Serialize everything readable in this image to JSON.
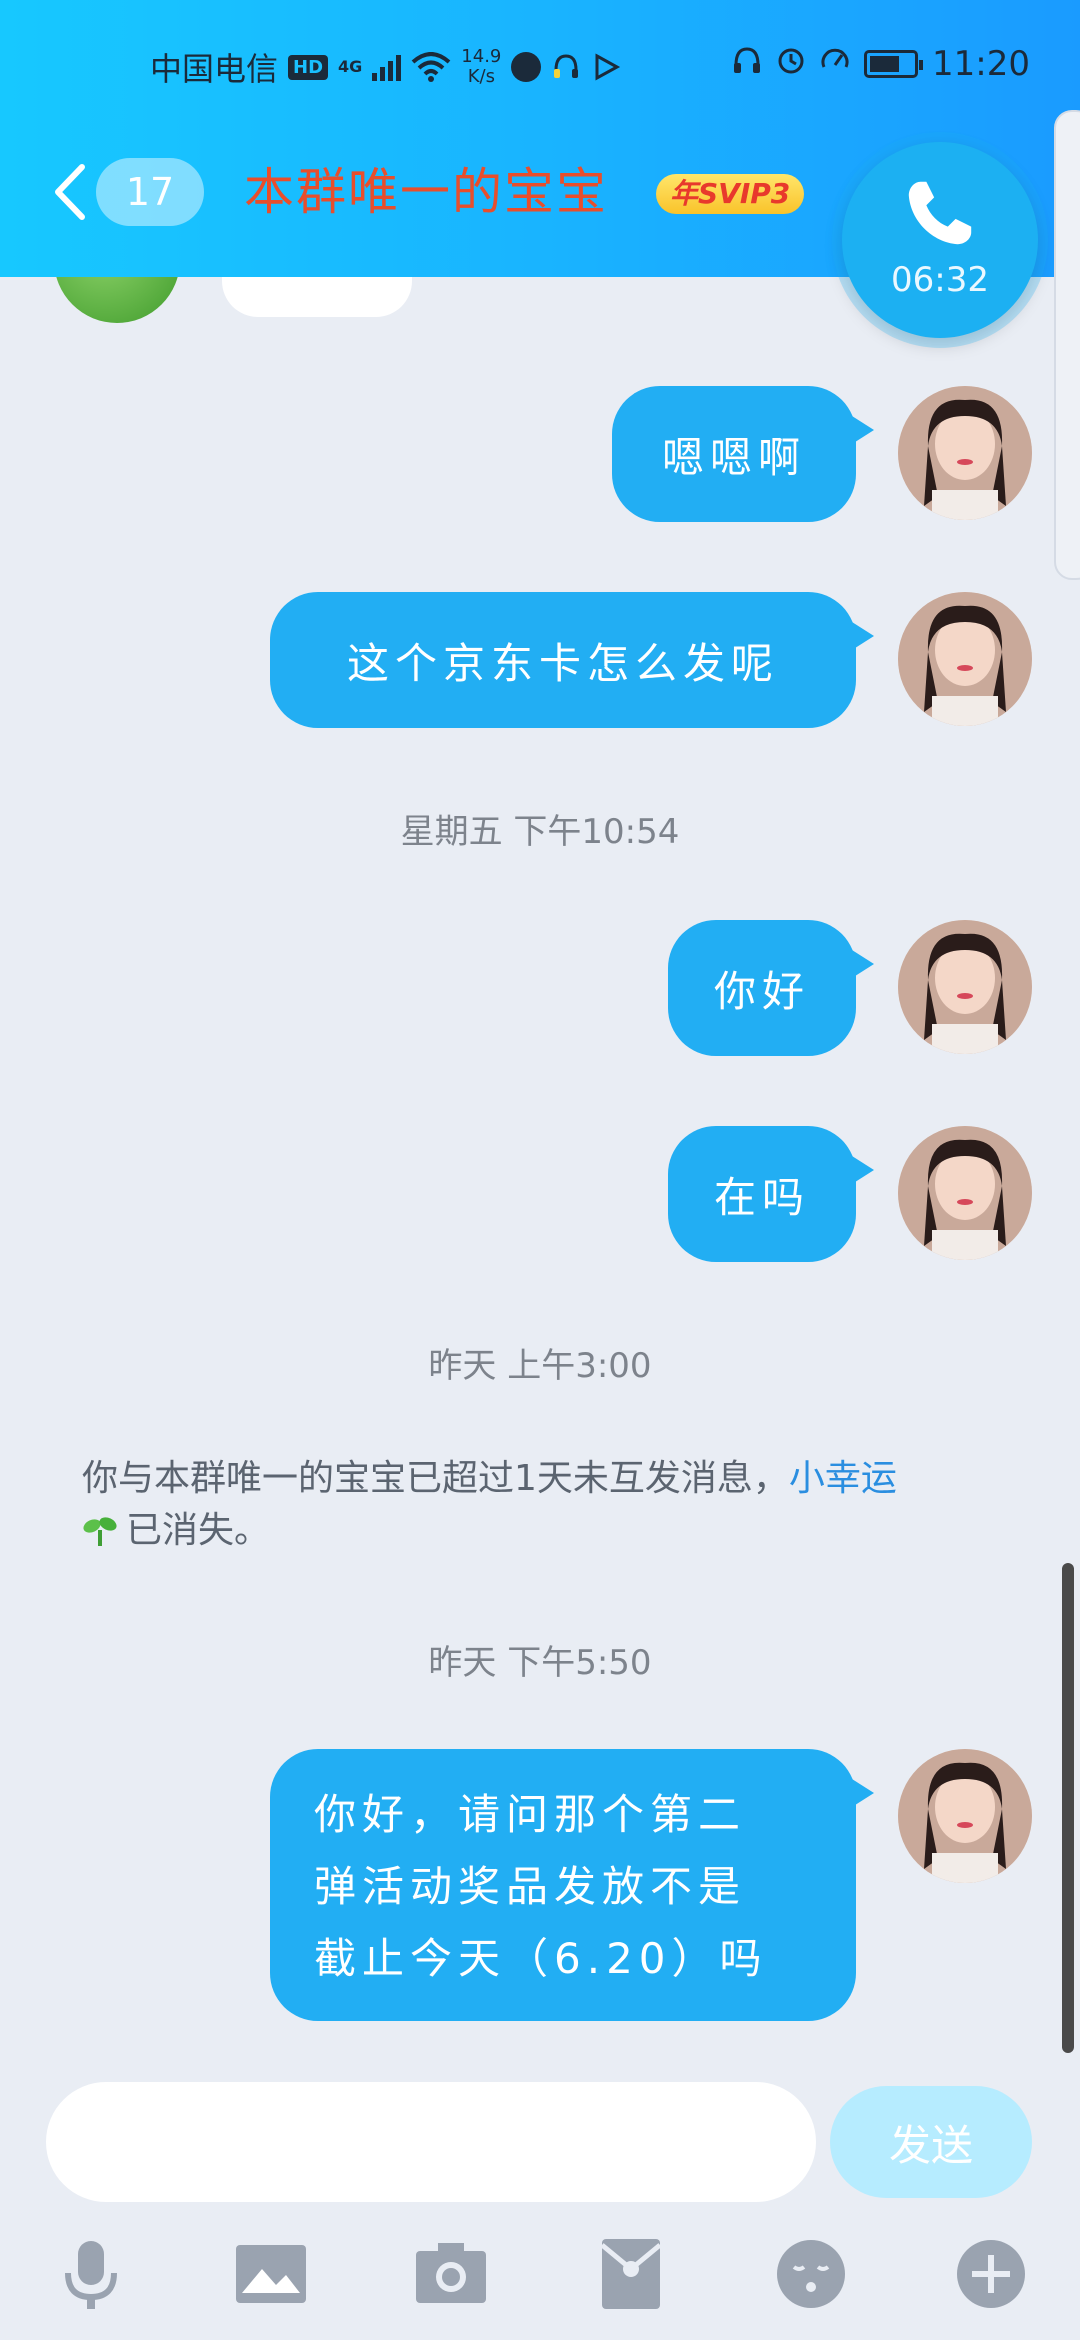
{
  "status_bar": {
    "carrier": "中国电信",
    "hd_badge": "HD",
    "network": "4G",
    "speed_value": "14.9",
    "speed_unit": "K/s",
    "time": "11:20"
  },
  "header": {
    "unread_count": "17",
    "title": "本群唯一的宝宝",
    "vip_badge": "年SVIP3"
  },
  "call": {
    "duration": "06:32"
  },
  "messages": [
    {
      "type": "outgoing",
      "text": "嗯嗯啊"
    },
    {
      "type": "outgoing",
      "text": "这个京东卡怎么发呢"
    },
    {
      "type": "timestamp",
      "text": "星期五 下午10:54"
    },
    {
      "type": "outgoing",
      "text": "你好"
    },
    {
      "type": "outgoing",
      "text": "在吗"
    },
    {
      "type": "timestamp",
      "text": "昨天 上午3:00"
    },
    {
      "type": "system",
      "text": "你与本群唯一的宝宝已超过1天未互发消息，",
      "link": "小幸运",
      "suffix": "已消失。"
    },
    {
      "type": "timestamp",
      "text": "昨天 下午5:50"
    },
    {
      "type": "outgoing",
      "text_lines": [
        "你好，请问那个第二",
        "弹活动奖品发放不是",
        "截止今天（6.20）吗"
      ]
    }
  ],
  "input": {
    "placeholder": "",
    "send_label": "发送"
  },
  "toolbar": [
    "microphone-icon",
    "image-icon",
    "camera-icon",
    "red-packet-icon",
    "emoji-icon",
    "plus-icon"
  ],
  "colors": {
    "header_gradient_start": "#17c8ff",
    "header_gradient_end": "#1a9bff",
    "bubble": "#22aef3",
    "background": "#e9edf4",
    "title": "#e84e2c",
    "link": "#2a8ee0",
    "send_disabled": "#b6ecff"
  }
}
